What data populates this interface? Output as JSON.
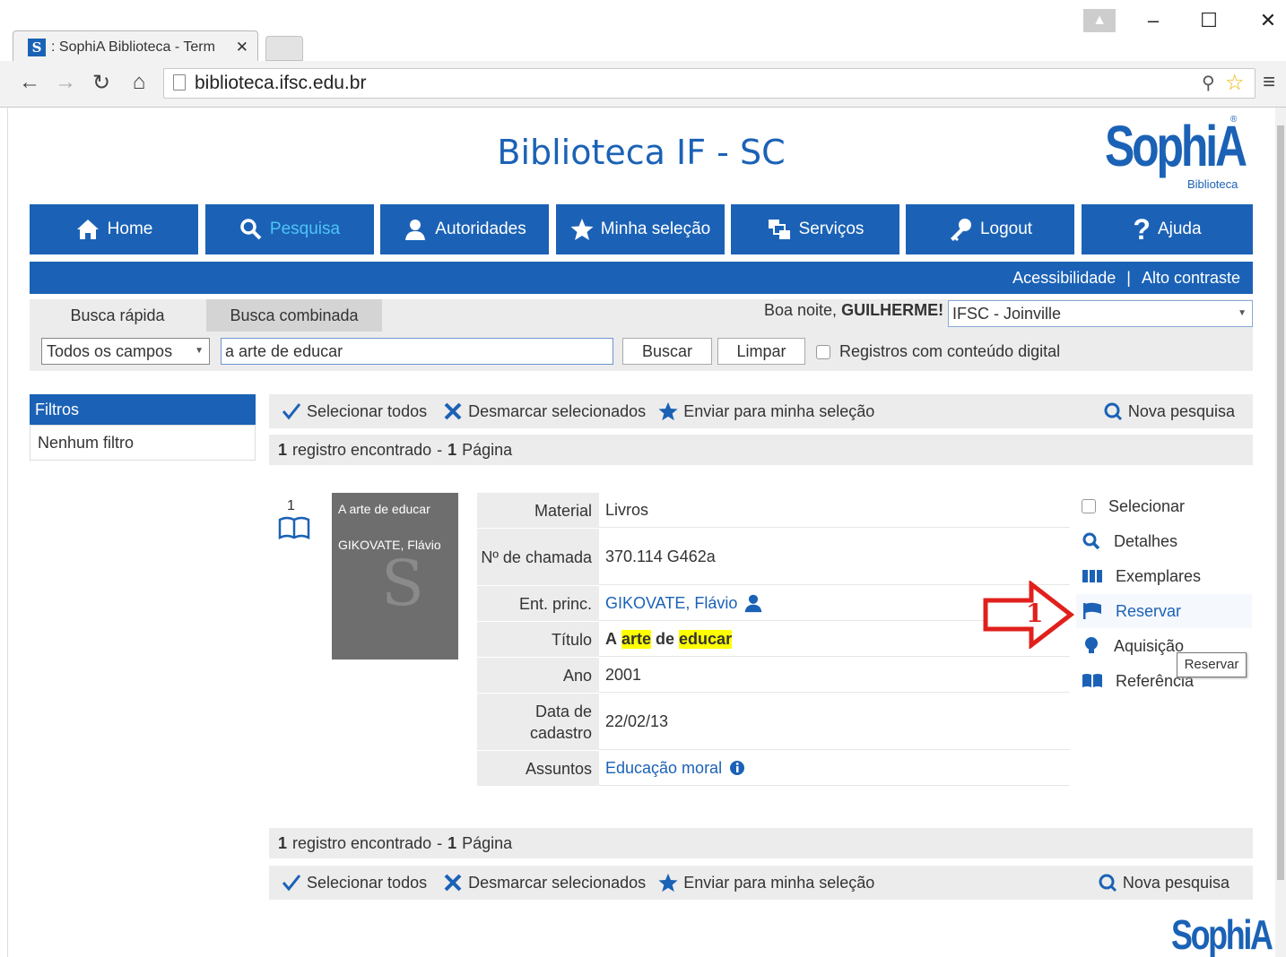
{
  "browser": {
    "tab_title": ": SophiA Biblioteca - Term",
    "url": "biblioteca.ifsc.edu.br"
  },
  "site": {
    "title": "Biblioteca IF - SC",
    "logo": "SophiA",
    "logo_sub": "Biblioteca"
  },
  "nav": {
    "items": [
      {
        "label": "Home",
        "icon": "home-icon"
      },
      {
        "label": "Pesquisa",
        "icon": "search-icon",
        "active": true
      },
      {
        "label": "Autoridades",
        "icon": "authority-icon"
      },
      {
        "label": "Minha seleção",
        "icon": "star-icon"
      },
      {
        "label": "Serviços",
        "icon": "services-icon"
      },
      {
        "label": "Logout",
        "icon": "key-icon"
      },
      {
        "label": "Ajuda",
        "icon": "help-icon"
      }
    ],
    "accessibility": "Acessibilidade",
    "separator": "|",
    "high_contrast": "Alto contraste"
  },
  "search": {
    "tab_quick": "Busca rápida",
    "tab_combined": "Busca combinada",
    "greeting_prefix": "Boa noite,",
    "greeting_name": "GUILHERME!",
    "campus": "IFSC - Joinville",
    "field": "Todos os campos",
    "term": "a arte de educar",
    "search_btn": "Buscar",
    "clear_btn": "Limpar",
    "digital_label": "Registros com conteúdo digital"
  },
  "filters": {
    "title": "Filtros",
    "empty": "Nenhum filtro"
  },
  "actions": {
    "select_all": "Selecionar todos",
    "deselect": "Desmarcar selecionados",
    "send": "Enviar para minha seleção",
    "new_search": "Nova pesquisa"
  },
  "results": {
    "count": "1",
    "count_label": "registro encontrado",
    "dash": "-",
    "pages": "1",
    "pages_label": "Página"
  },
  "record": {
    "number": "1",
    "cover_title": "A arte de educar",
    "cover_author": "GIKOVATE, Flávio",
    "fields": {
      "material_label": "Material",
      "material": "Livros",
      "call_label": "Nº de chamada",
      "call": "370.114 G462a",
      "author_label": "Ent. princ.",
      "author": "GIKOVATE, Flávio",
      "title_label": "Título",
      "title_a": "A",
      "title_b": "arte",
      "title_c": "de",
      "title_d": "educar",
      "year_label": "Ano",
      "year": "2001",
      "date_label": "Data de cadastro",
      "date": "22/02/13",
      "subject_label": "Assuntos",
      "subject": "Educação moral"
    }
  },
  "side_actions": {
    "select": "Selecionar",
    "details": "Detalhes",
    "copies": "Exemplares",
    "reserve": "Reservar",
    "acquisition": "Aquisição",
    "reference": "Referência"
  },
  "annotation": {
    "number": "1",
    "color": "#e0201c"
  },
  "tooltip": "Reservar",
  "colors": {
    "brand": "#1b62b6",
    "highlight": "#ffff00"
  }
}
